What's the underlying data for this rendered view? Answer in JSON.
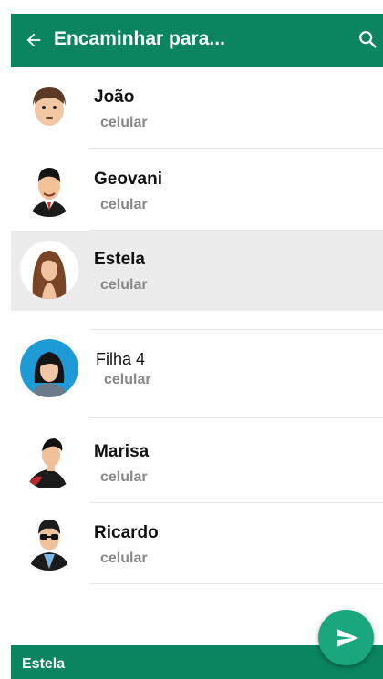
{
  "header": {
    "title": "Encaminhar para...",
    "back_icon": "arrow-left-icon",
    "search_icon": "search-icon",
    "color": "#0a8560"
  },
  "contacts": [
    {
      "name": "João",
      "subtitle": "celular",
      "selected": false
    },
    {
      "name": "Geovani",
      "subtitle": "celular",
      "selected": false
    },
    {
      "name": "Estela",
      "subtitle": "celular",
      "selected": true
    },
    {
      "name": "Filha 4",
      "subtitle": "celular",
      "selected": false
    },
    {
      "name": "Marisa",
      "subtitle": "celular",
      "selected": false
    },
    {
      "name": "Ricardo",
      "subtitle": "celular",
      "selected": false
    }
  ],
  "fab": {
    "icon": "send-icon",
    "color": "#1aa77d"
  },
  "bottom_bar": {
    "selected_names": "Estela"
  }
}
